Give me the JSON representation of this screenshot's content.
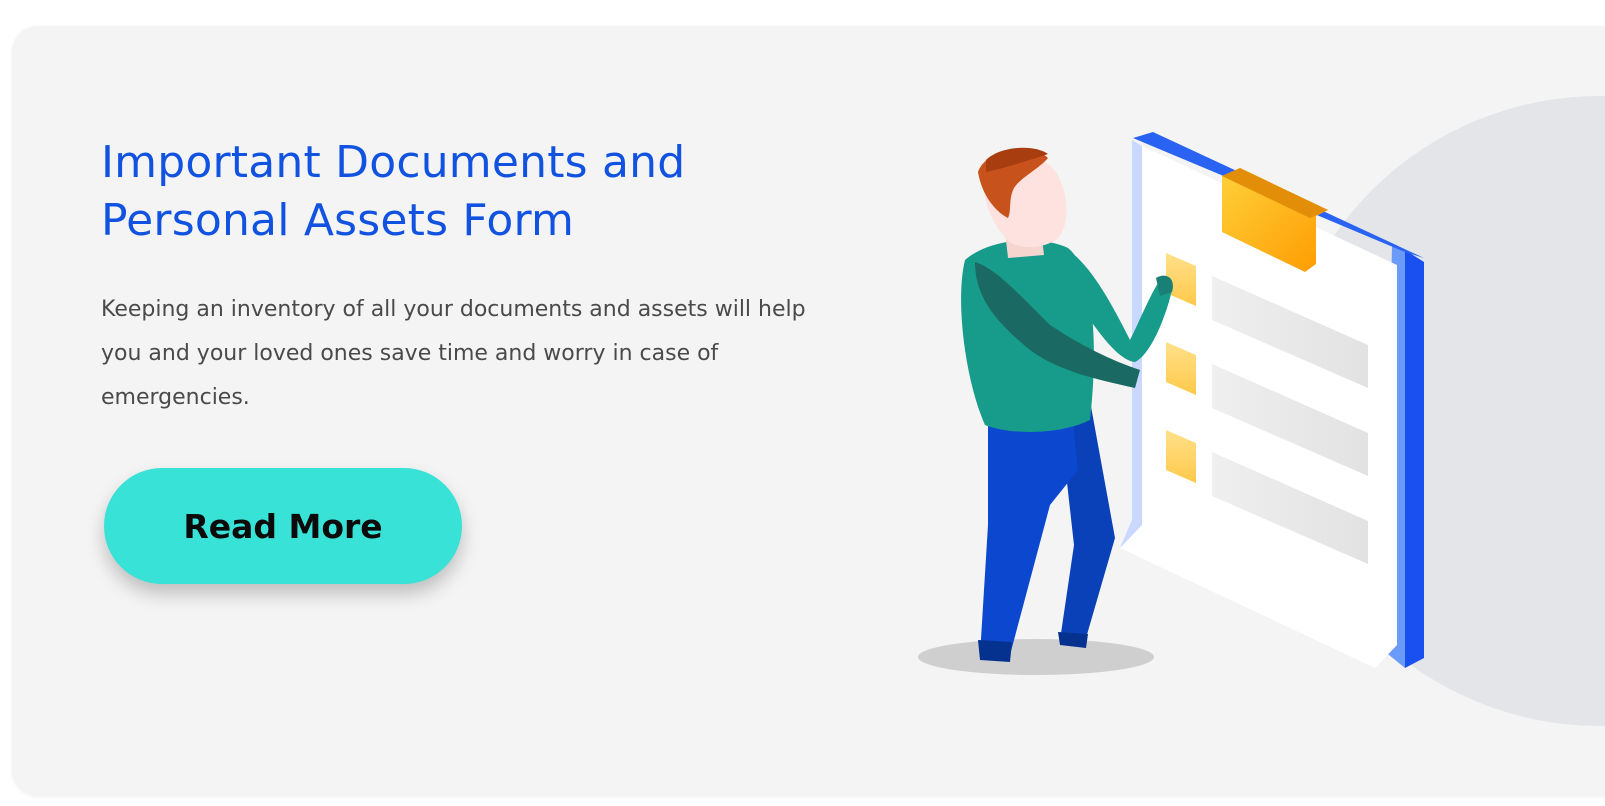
{
  "card": {
    "title": "Important Documents and Personal Assets Form",
    "description": "Keeping an inventory of all your documents and assets will help you and your loved ones save time and worry in case of emergencies.",
    "button_label": "Read More"
  },
  "illustration": {
    "icon": "person-holding-checklist-clipboard",
    "clipboard_items": 3
  },
  "colors": {
    "title": "#1153e0",
    "button": "#38e2d6",
    "card_background": "#f4f4f4",
    "text": "#4a4a4a"
  }
}
